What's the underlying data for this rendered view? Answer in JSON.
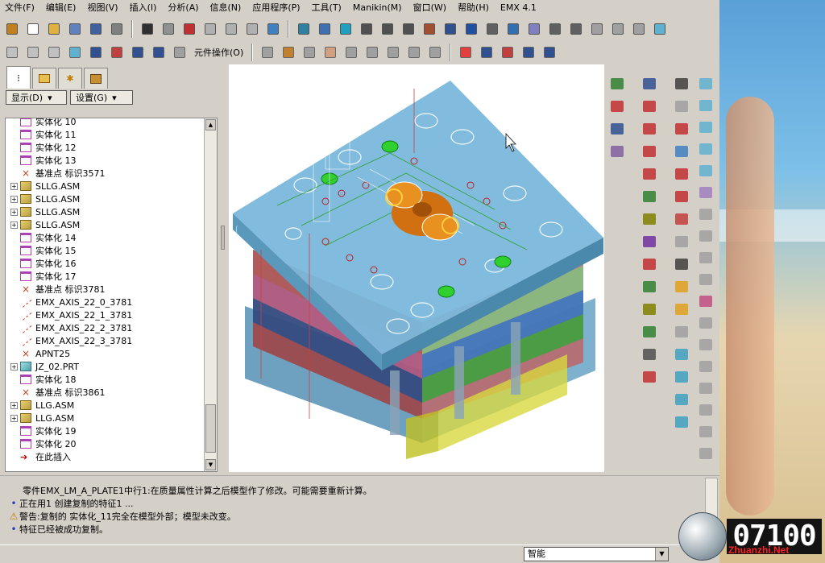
{
  "menu": [
    "文件(F)",
    "编辑(E)",
    "视图(V)",
    "插入(I)",
    "分析(A)",
    "信息(N)",
    "应用程序(P)",
    "工具(T)",
    "Manikin(M)",
    "窗口(W)",
    "帮助(H)",
    "EMX 4.1"
  ],
  "toolbar2": {
    "component_ops": "元件操作(O)"
  },
  "leftpanel": {
    "show_label": "显示(D)",
    "settings_label": "设置(G)",
    "tree": [
      {
        "label": "实体化 10",
        "type": "solid",
        "expand": false
      },
      {
        "label": "实体化 11",
        "type": "solid",
        "expand": false
      },
      {
        "label": "实体化 12",
        "type": "solid",
        "expand": false
      },
      {
        "label": "实体化 13",
        "type": "solid",
        "expand": false
      },
      {
        "label": "基准点 标识3571",
        "type": "datum",
        "expand": false
      },
      {
        "label": "SLLG.ASM",
        "type": "asm",
        "expand": true
      },
      {
        "label": "SLLG.ASM",
        "type": "asm",
        "expand": true
      },
      {
        "label": "SLLG.ASM",
        "type": "asm",
        "expand": true
      },
      {
        "label": "SLLG.ASM",
        "type": "asm",
        "expand": true
      },
      {
        "label": "实体化 14",
        "type": "solid",
        "expand": false
      },
      {
        "label": "实体化 15",
        "type": "solid",
        "expand": false
      },
      {
        "label": "实体化 16",
        "type": "solid",
        "expand": false
      },
      {
        "label": "实体化 17",
        "type": "solid",
        "expand": false
      },
      {
        "label": "基准点 标识3781",
        "type": "datum",
        "expand": false
      },
      {
        "label": "EMX_AXIS_22_0_3781",
        "type": "axis",
        "expand": false
      },
      {
        "label": "EMX_AXIS_22_1_3781",
        "type": "axis",
        "expand": false
      },
      {
        "label": "EMX_AXIS_22_2_3781",
        "type": "axis",
        "expand": false
      },
      {
        "label": "EMX_AXIS_22_3_3781",
        "type": "axis",
        "expand": false
      },
      {
        "label": "APNT25",
        "type": "datum",
        "expand": false
      },
      {
        "label": "JZ_02.PRT",
        "type": "prt",
        "expand": true
      },
      {
        "label": "实体化 18",
        "type": "solid",
        "expand": false
      },
      {
        "label": "基准点 标识3861",
        "type": "datum",
        "expand": false
      },
      {
        "label": "LLG.ASM",
        "type": "asm",
        "expand": true
      },
      {
        "label": "LLG.ASM",
        "type": "asm",
        "expand": true
      },
      {
        "label": "实体化 19",
        "type": "solid",
        "expand": false
      },
      {
        "label": "实体化 20",
        "type": "solid",
        "expand": false
      },
      {
        "label": "在此插入",
        "type": "insert",
        "expand": false
      }
    ]
  },
  "messages": [
    {
      "icon": "none",
      "text": "零件EMX_LM_A_PLATE1中行1:在质量属性计算之后模型作了修改。可能需要重新计算。"
    },
    {
      "icon": "bullet",
      "text": "正在用1 创建复制的特征1 ..."
    },
    {
      "icon": "warning",
      "text": "警告:复制的 实体化_11完全在模型外部；模型未改变。"
    },
    {
      "icon": "bullet",
      "text": "特征已经被成功复制。"
    }
  ],
  "status": {
    "filter": "智能"
  },
  "watermark": {
    "number": "07100",
    "url": "Zhuanzhi.Net"
  }
}
